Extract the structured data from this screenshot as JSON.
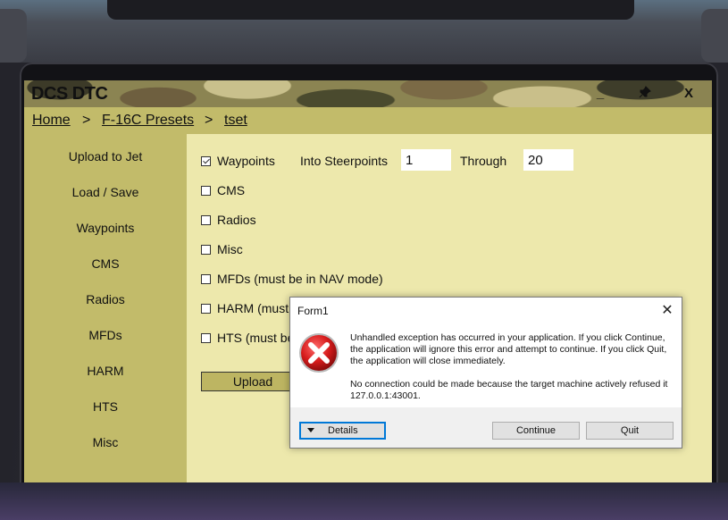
{
  "app": {
    "title": "DCS DTC",
    "minimize": "_",
    "pin_icon": "pin-icon",
    "close": "X"
  },
  "breadcrumb": {
    "home": "Home",
    "sep1": ">",
    "presets": "F-16C Presets",
    "sep2": ">",
    "current": "tset"
  },
  "sidebar": {
    "items": [
      {
        "label": "Upload to Jet"
      },
      {
        "label": "Load / Save"
      },
      {
        "label": "Waypoints"
      },
      {
        "label": "CMS"
      },
      {
        "label": "Radios"
      },
      {
        "label": "MFDs"
      },
      {
        "label": "HARM"
      },
      {
        "label": "HTS"
      },
      {
        "label": "Misc"
      }
    ]
  },
  "upload": {
    "options": [
      {
        "label": "Waypoints",
        "checked": true
      },
      {
        "label": "CMS",
        "checked": false
      },
      {
        "label": "Radios",
        "checked": false
      },
      {
        "label": "Misc",
        "checked": false
      },
      {
        "label": "MFDs (must be in NAV mode)",
        "checked": false
      },
      {
        "label": "HARM (must be in ...",
        "checked": false
      },
      {
        "label": "HTS (must be ...",
        "checked": false
      }
    ],
    "into_label": "Into Steerpoints",
    "from_value": "1",
    "through_label": "Through",
    "to_value": "20",
    "button_label": "Upload"
  },
  "dialog": {
    "title": "Form1",
    "close": "✕",
    "icon": "error-icon",
    "message1": "Unhandled exception has occurred in your application. If you click Continue, the application will ignore this error and attempt to continue. If you click Quit, the application will close immediately.",
    "message2": "No connection could be made because the target machine actively refused it 127.0.0.1:43001.",
    "details_label": "Details",
    "continue_label": "Continue",
    "quit_label": "Quit"
  }
}
